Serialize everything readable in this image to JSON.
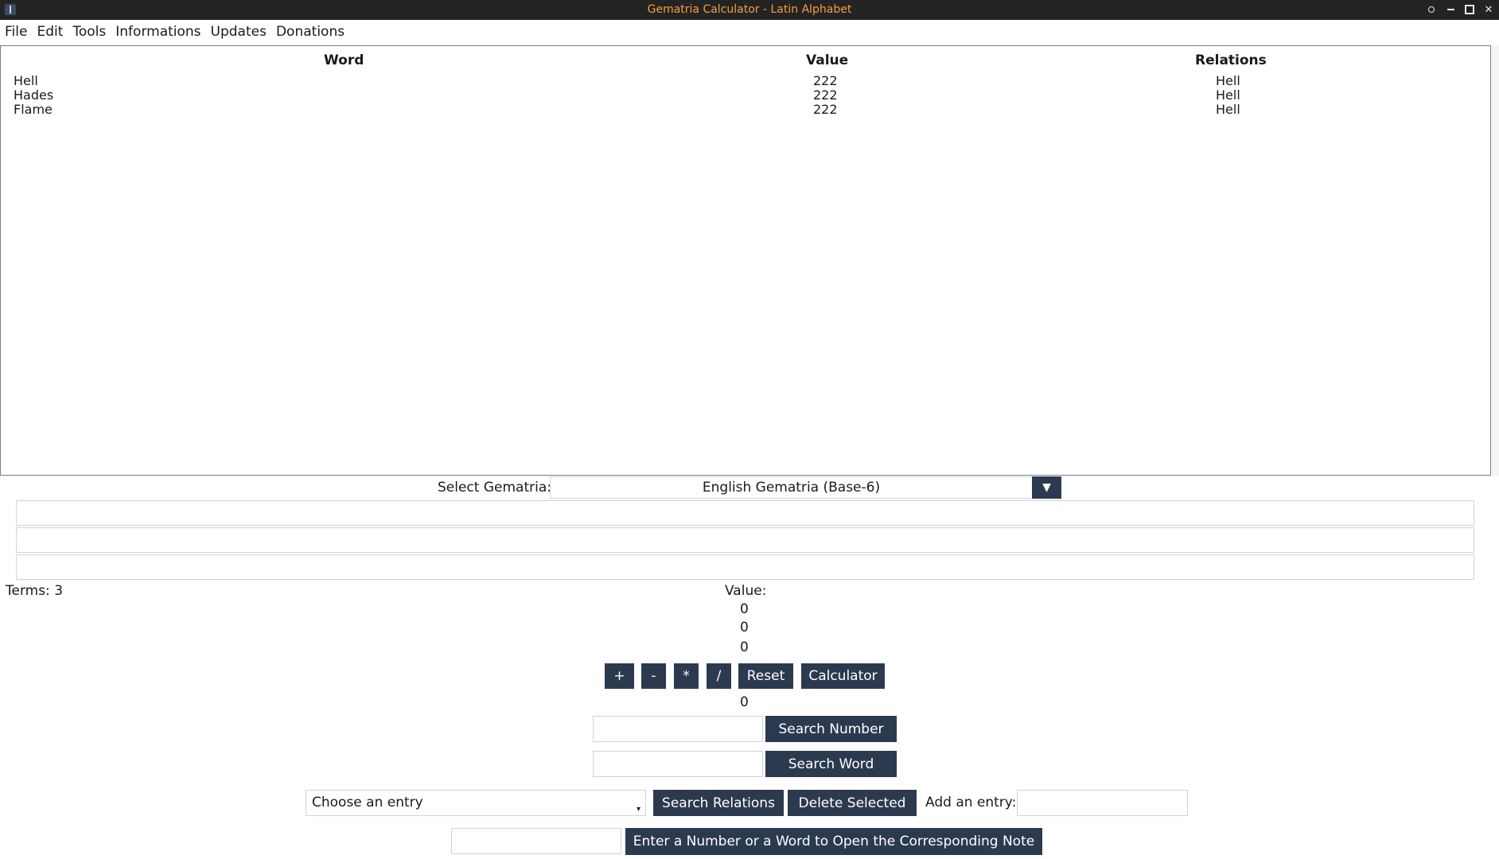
{
  "window": {
    "title": "Gematria Calculator - Latin Alphabet"
  },
  "menu": [
    "File",
    "Edit",
    "Tools",
    "Informations",
    "Updates",
    "Donations"
  ],
  "table": {
    "headers": {
      "word": "Word",
      "value": "Value",
      "relations": "Relations"
    },
    "rows": [
      {
        "word": "Hell",
        "value": "222",
        "relations": "Hell"
      },
      {
        "word": "Hades",
        "value": "222",
        "relations": "Hell"
      },
      {
        "word": "Flame",
        "value": "222",
        "relations": "Hell"
      }
    ]
  },
  "gematria": {
    "label": "Select Gematria:",
    "selected": "English Gematria (Base-6)"
  },
  "inputs": {
    "term1": "",
    "term2": "",
    "term3": ""
  },
  "terms_label": "Terms: 3",
  "value_label": "Value:",
  "values": [
    "0",
    "0",
    "0"
  ],
  "operations": {
    "add": "+",
    "subtract": "-",
    "multiply": "*",
    "divide": "/",
    "reset": "Reset",
    "calculator": "Calculator"
  },
  "result": "0",
  "search": {
    "number_button": "Search Number",
    "word_button": "Search Word"
  },
  "entry": {
    "choose_placeholder": "Choose an entry",
    "search_relations": "Search Relations",
    "delete_selected": "Delete Selected",
    "add_label": "Add an entry:"
  },
  "note": {
    "button": "Enter a Number or a Word to Open the Corresponding Note"
  }
}
